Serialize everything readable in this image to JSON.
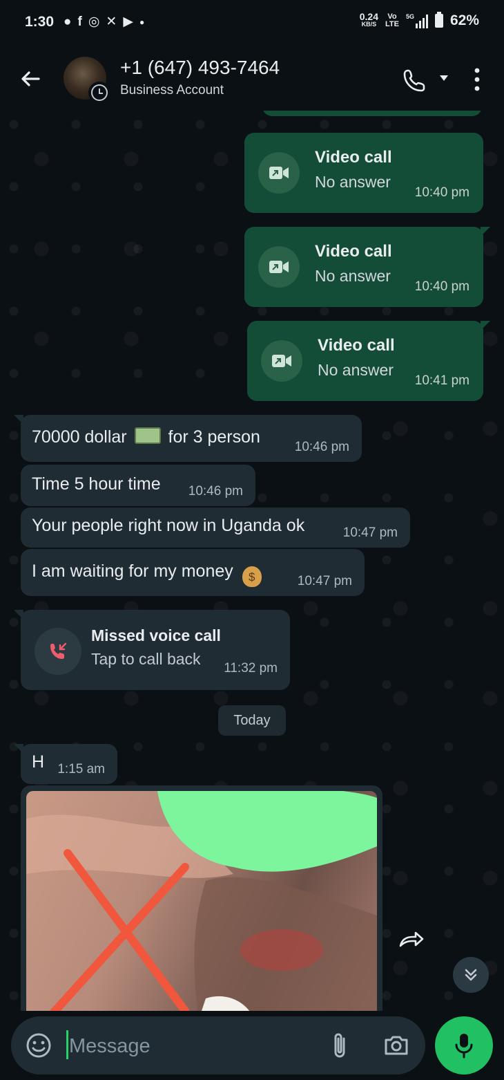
{
  "status_bar": {
    "time": "1:30",
    "network_speed": "0.24",
    "network_unit": "KB/S",
    "volte_top": "Vo",
    "volte_bottom": "LTE",
    "signal_label": "5G",
    "battery": "62%"
  },
  "header": {
    "contact_name": "+1 (647) 493-7464",
    "subtitle": "Business Account"
  },
  "messages": {
    "video_calls": [
      {
        "title": "Video call",
        "status": "No answer",
        "time": "10:40 pm"
      },
      {
        "title": "Video call",
        "status": "No answer",
        "time": "10:40 pm"
      },
      {
        "title": "Video call",
        "status": "No answer",
        "time": "10:41 pm"
      }
    ],
    "incoming": [
      {
        "text": "70000 dollar",
        "text_after": "for 3 person",
        "time": "10:46 pm"
      },
      {
        "text": "Time 5 hour time",
        "time": "10:46 pm"
      },
      {
        "text": "Your people right now in Uganda ok",
        "time": "10:47 pm"
      },
      {
        "text": "I am waiting for my money",
        "time": "10:47 pm"
      }
    ],
    "missed_call": {
      "title": "Missed voice call",
      "subtitle": "Tap to call back",
      "time": "11:32 pm"
    },
    "date_divider": "Today",
    "last_text": {
      "text": "H",
      "time": "1:15 am"
    }
  },
  "composer": {
    "placeholder": "Message"
  },
  "colors": {
    "background": "#0b1014",
    "outgoing_bubble": "#144d37",
    "incoming_bubble": "#202c33",
    "accent_green": "#21c063",
    "missed_red": "#f15c6d",
    "censor_green": "#7cf59c",
    "mark_red": "#f0573c"
  },
  "icons": [
    "back-arrow-icon",
    "voice-call-icon",
    "more-options-icon",
    "video-call-icon",
    "missed-call-icon",
    "forward-icon",
    "scroll-down-icon",
    "emoji-icon",
    "attach-icon",
    "camera-icon",
    "mic-icon",
    "cash-emoji",
    "money-bag-emoji"
  ]
}
